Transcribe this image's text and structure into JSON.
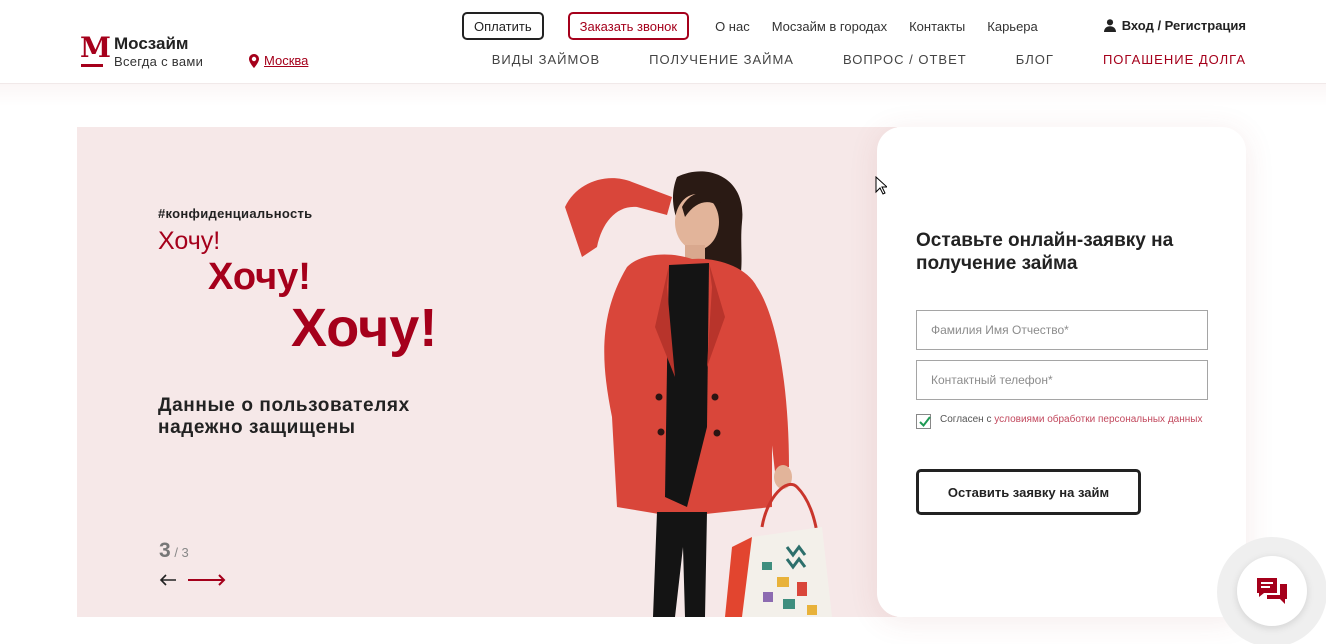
{
  "header": {
    "logo_name": "Мосзайм",
    "logo_slogan": "Всегда с вами",
    "city": "Москва",
    "pay_button": "Оплатить",
    "callback_button": "Заказать звонок",
    "top_links": [
      "О нас",
      "Мосзайм в городах",
      "Контакты",
      "Карьера"
    ],
    "login": "Вход / Регистрация",
    "nav": [
      "ВИДЫ ЗАЙМОВ",
      "ПОЛУЧЕНИЕ ЗАЙМА",
      "ВОПРОС / ОТВЕТ",
      "БЛОГ",
      "ПОГАШЕНИЕ ДОЛГА"
    ]
  },
  "hero": {
    "hashtag": "#конфиденциальность",
    "want_1": "Хочу!",
    "want_2": "Хочу!",
    "want_3": "Хочу!",
    "description": "Данные о пользователях надежно защищены",
    "slide_current": "3",
    "slide_total": "/ 3"
  },
  "form": {
    "title": "Оставьте онлайн-заявку на получение займа",
    "name_placeholder": "Фамилия Имя Отчество*",
    "phone_placeholder": "Контактный телефон*",
    "agree_text": "Согласен с ",
    "agree_link": "условиями обработки персональных данных",
    "agree_checked": true,
    "submit": "Оставить заявку на займ"
  },
  "colors": {
    "brand": "#a5001b",
    "hero_bg": "#f6e8e8",
    "coat": "#d9463a"
  },
  "icons": {
    "logo": "logo-m-icon",
    "city": "map-pin-icon",
    "login": "user-icon",
    "prev": "arrow-left-icon",
    "next": "arrow-right-icon",
    "chat": "chat-bubbles-icon"
  }
}
